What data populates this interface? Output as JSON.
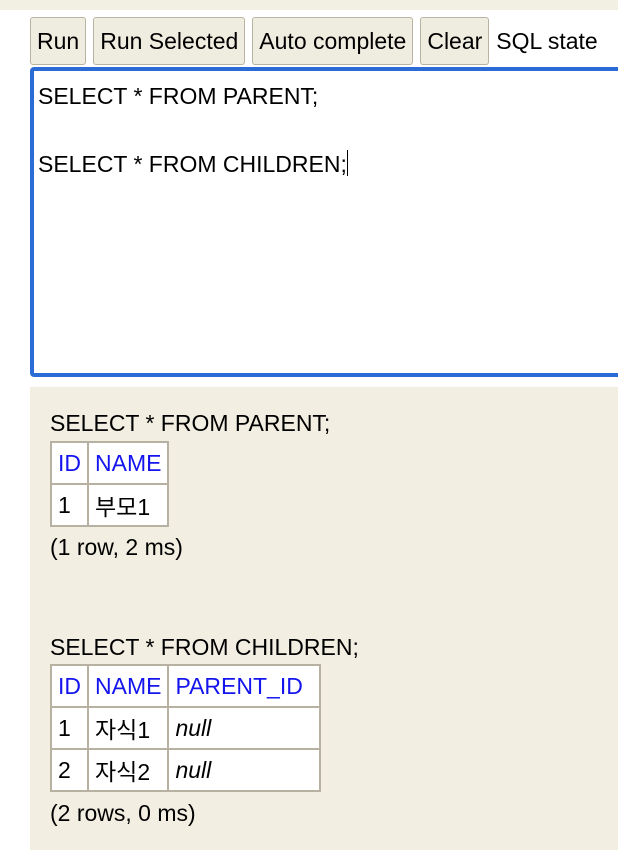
{
  "toolbar": {
    "run_label": "Run",
    "run_selected_label": "Run Selected",
    "auto_complete_label": "Auto complete",
    "clear_label": "Clear",
    "sql_statement_label": "SQL state"
  },
  "editor": {
    "lines": [
      "SELECT * FROM PARENT;",
      "",
      "SELECT * FROM CHILDREN;"
    ]
  },
  "results": [
    {
      "statement": "SELECT * FROM PARENT;",
      "columns": [
        "ID",
        "NAME"
      ],
      "rows": [
        [
          "1",
          "부모1"
        ]
      ],
      "summary": "(1 row, 2 ms)"
    },
    {
      "statement": "SELECT * FROM CHILDREN;",
      "columns": [
        "ID",
        "NAME",
        "PARENT_ID"
      ],
      "rows": [
        [
          "1",
          "자식1",
          "null"
        ],
        [
          "2",
          "자식2",
          "null"
        ]
      ],
      "summary": "(2 rows, 0 ms)"
    }
  ],
  "colors": {
    "editor_border": "#2b6bd6",
    "results_background": "#f2eee1",
    "header_text": "#1414ee"
  }
}
